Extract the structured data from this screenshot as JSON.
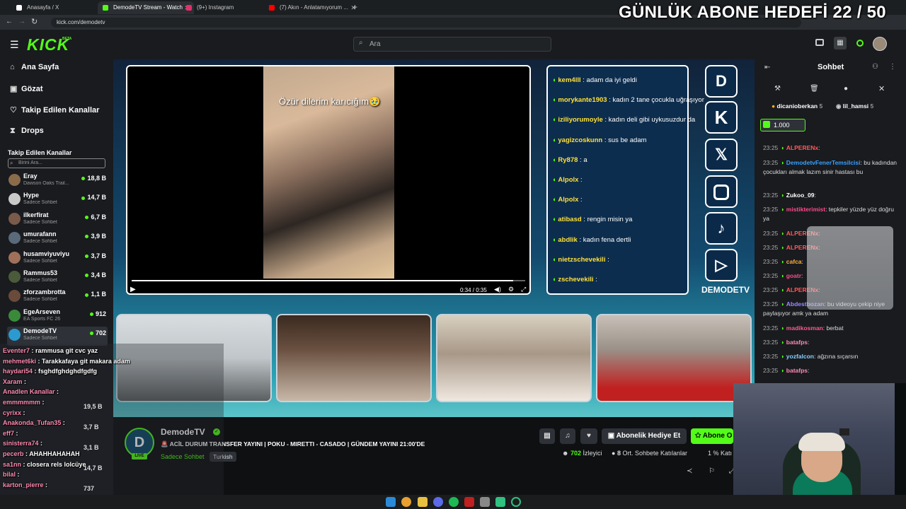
{
  "tabs": [
    {
      "label": "Anasayfa / X",
      "color": "#ffffff"
    },
    {
      "label": "DemodeTV Stream - Watch",
      "color": "#53fc18"
    },
    {
      "label": "(9+) Instagram",
      "color": "#e1306c"
    },
    {
      "label": "(7) Akın - Anlatamıyorum ...",
      "color": "#ff0000"
    }
  ],
  "url": "kick.com/demodetv",
  "goal_overlay": "GÜNLÜK ABONE HEDEFİ 22 / 50",
  "header": {
    "logo": "KICK",
    "logo_beta": "BETA",
    "search_placeholder": "Ara"
  },
  "nav": [
    {
      "label": "Ana Sayfa",
      "icon": "home-icon"
    },
    {
      "label": "Gözat",
      "icon": "browse-icon"
    },
    {
      "label": "Takip Edilen Kanallar",
      "icon": "heart-icon"
    },
    {
      "label": "Drops",
      "icon": "drops-icon"
    }
  ],
  "following": {
    "title": "Takip Edilen Kanallar",
    "search_placeholder": "Birini Ara...",
    "channels": [
      {
        "name": "Eray",
        "category": "Dawson Oaks Trail...",
        "viewers": "18,8 B",
        "color": "#8a6b4a"
      },
      {
        "name": "Hype",
        "category": "Sadece Sohbet",
        "viewers": "14,7 B",
        "color": "#c9c9c9"
      },
      {
        "name": "ilkerfirat",
        "category": "Sadece Sohbet",
        "viewers": "6,7 B",
        "color": "#7a5a4a"
      },
      {
        "name": "umurafann",
        "category": "Sadece Sohbet",
        "viewers": "3,9 B",
        "color": "#5a6a7a"
      },
      {
        "name": "husamviyuviyu",
        "category": "Sadece Sohbet",
        "viewers": "3,7 B",
        "color": "#a0705a"
      },
      {
        "name": "Rammus53",
        "category": "Sadece Sohbet",
        "viewers": "3,4 B",
        "color": "#4a5a3a"
      },
      {
        "name": "zforzambrotta",
        "category": "Sadece Sohbet",
        "viewers": "1,1 B",
        "color": "#6a4a3a"
      },
      {
        "name": "EgeArseven",
        "category": "EA Sports FC 26",
        "viewers": "912",
        "color": "#3a8a3a"
      },
      {
        "name": "DemodeTV",
        "category": "Sadece Sohbet",
        "viewers": "702",
        "color": "#2a9ad0"
      }
    ]
  },
  "overlay_chat_messages": [
    {
      "user": "kem4lll",
      "text": "adam da iyi geldi"
    },
    {
      "user": "morykante1903",
      "text": "kadın 2 tane çocukla uğraşıyor"
    },
    {
      "user": "iziliyorumoyle",
      "text": "kadın deli gibi uykusuzdur da"
    },
    {
      "user": "yagizcoskunn",
      "text": "sus be adam"
    },
    {
      "user": "Ry878",
      "text": "a"
    },
    {
      "user": "Alpolx",
      "text": ""
    },
    {
      "user": "Alpolx",
      "text": ""
    },
    {
      "user": "atibasd",
      "text": "rengin misin ya"
    },
    {
      "user": "abdlik",
      "text": "kadın fena dertli"
    },
    {
      "user": "nietzschevekili",
      "text": ""
    },
    {
      "user": "zschevekili",
      "text": ""
    }
  ],
  "video": {
    "caption": "Özür dilerim karıcığım🥹",
    "time": "0:34 / 0:35",
    "progress": 0.97
  },
  "socials_brand": "DEMODETV",
  "socials": [
    "demodetv-logo-icon",
    "kick-icon",
    "x-icon",
    "instagram-icon",
    "tiktok-icon",
    "youtube-icon"
  ],
  "side_chat": {
    "title": "Sohbet",
    "pinned": [
      {
        "user": "dicanioberkan",
        "count": "5"
      },
      {
        "user": "lil_hamsi",
        "count": "5"
      }
    ],
    "gift_count": "1.000",
    "messages": [
      {
        "time": "23:25",
        "user": "ALPERENx",
        "text": "",
        "color": "#ff5a5a"
      },
      {
        "time": "23:25",
        "user": "DemodetvFenerTemsilcisi",
        "text": "bu kadından çocukları almak lazım sinir hastası bu",
        "color": "#3aa0ff"
      },
      {
        "time": "23:25",
        "user": "Zukoo_09",
        "text": "",
        "color": "#ffffff"
      },
      {
        "time": "23:25",
        "user": "mistikterimist",
        "text": "tepkiler yüzde yüz doğru ya",
        "color": "#ff4a8a"
      },
      {
        "time": "23:25",
        "user": "ALPERENx",
        "text": "",
        "color": "#ff5a5a"
      },
      {
        "time": "23:25",
        "user": "ALPERENx",
        "text": "",
        "color": "#ff5a5a"
      },
      {
        "time": "23:25",
        "user": "cafca",
        "text": "",
        "color": "#ffb040"
      },
      {
        "time": "23:25",
        "user": "goatr",
        "text": "",
        "color": "#ff4a8a"
      },
      {
        "time": "23:25",
        "user": "ALPERENx",
        "text": "",
        "color": "#ff5a5a"
      },
      {
        "time": "23:25",
        "user": "Abdestbozan",
        "text": "bu videoyu çekip niye paylaşıyor amk ya adam",
        "color": "#9a8aff"
      },
      {
        "time": "23:25",
        "user": "madikosman",
        "text": "berbat",
        "color": "#ff5a8a"
      },
      {
        "time": "23:25",
        "user": "batafps",
        "text": "",
        "color": "#ff8ab0"
      },
      {
        "time": "23:25",
        "user": "yozfalcon",
        "text": "ağzına sıçarsın",
        "color": "#8ad0ff"
      },
      {
        "time": "23:25",
        "user": "batafps",
        "text": "",
        "color": "#ff8ab0"
      }
    ]
  },
  "streamer": {
    "name": "DemodeTV",
    "title": "🚨 ACİL DURUM TRANSFER YAYINI | POKU - MIRETTI - CASADO | GÜNDEM YAYINI 21:00'DE",
    "category": "Sadece Sohbet",
    "tag": "Turkish",
    "viewers": "702",
    "viewers_label": "İzleyici",
    "chatters_count": "8",
    "chatters_label": "Ort. Sohbete Katılanlar",
    "pct": "1 % Katı",
    "gift_button": "Abonelik Hediye Et",
    "sub_button": "Abone O"
  },
  "overlay_left_chat": [
    {
      "user": "Eventer7",
      "text": "rammusa git cvc yaz"
    },
    {
      "user": "mehmet6ki",
      "text": "Tarakkafaya git makara adam"
    },
    {
      "user": "haydari54",
      "text": "fsghdfghdghdfgdfg"
    },
    {
      "user": "Xaram",
      "text": ""
    },
    {
      "user": "Anadlen Kanallar",
      "text": ""
    },
    {
      "user": "emmmmmm",
      "text": ""
    },
    {
      "user": "cyrixx",
      "text": ""
    },
    {
      "user": "Anakonda_Tufan35",
      "text": ""
    },
    {
      "user": "eff7",
      "text": ""
    },
    {
      "user": "sinisterra74",
      "text": ""
    },
    {
      "user": "pecerb",
      "text": "AHAHHAHAHAH"
    },
    {
      "user": "sa1nn",
      "text": "closera rels lolcüye"
    },
    {
      "user": "bilal",
      "text": ""
    },
    {
      "user": "karton_pierre",
      "text": ""
    }
  ],
  "ghost_viewers": [
    "19,5 B",
    "3,7 B",
    "3,1 B",
    "14,7 B",
    "737"
  ]
}
